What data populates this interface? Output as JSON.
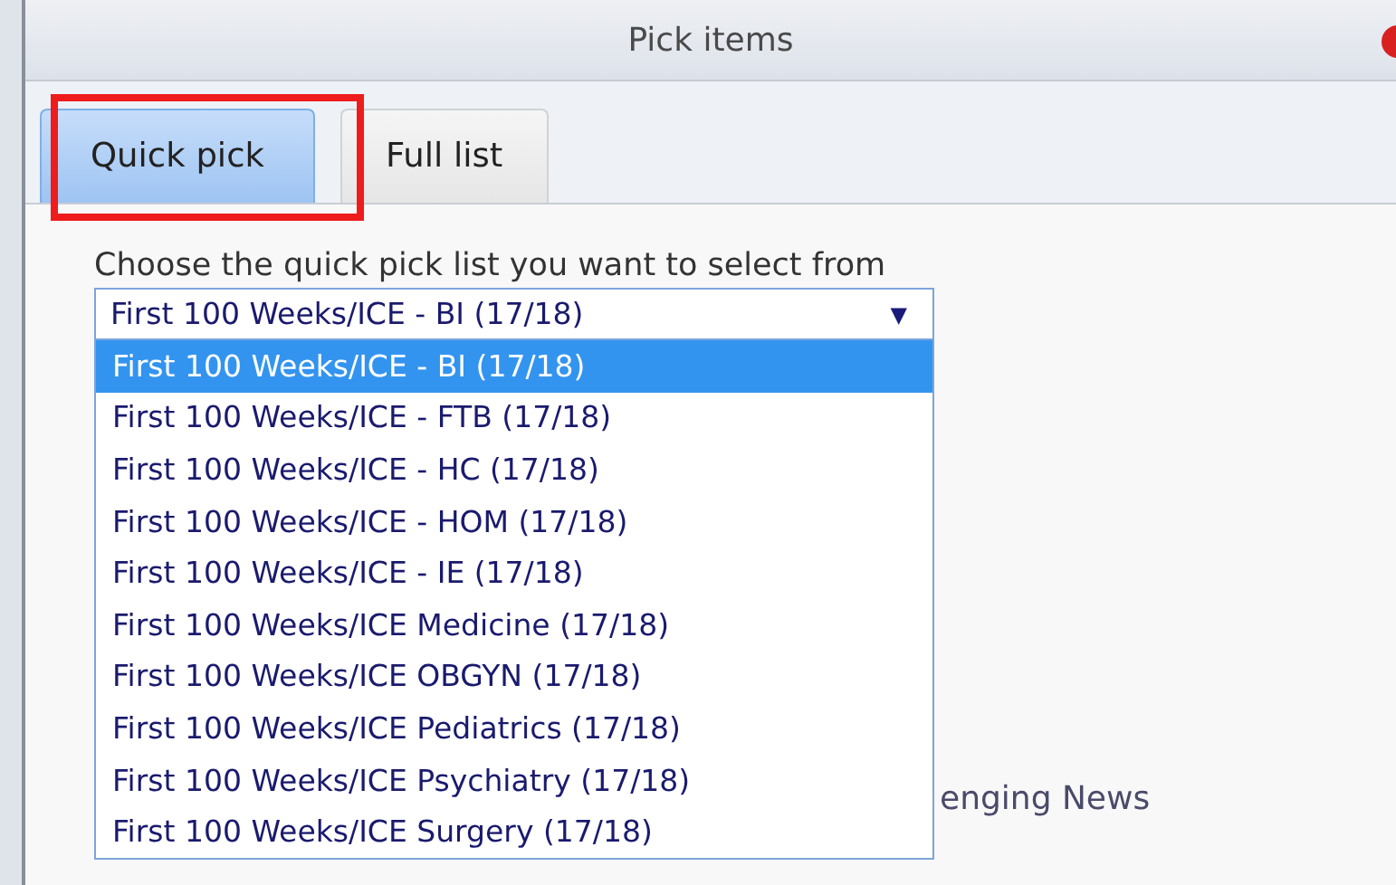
{
  "window": {
    "title": "Pick items"
  },
  "tabs": [
    {
      "label": "Quick pick",
      "selected": true
    },
    {
      "label": "Full list",
      "selected": false
    }
  ],
  "prompt": "Choose the quick pick list you want to select from",
  "select": {
    "value": "First 100 Weeks/ICE - BI (17/18)",
    "arrow": "▼",
    "expanded": true,
    "options": [
      {
        "label": "First 100 Weeks/ICE - BI (17/18)",
        "selected": true
      },
      {
        "label": "First 100 Weeks/ICE - FTB (17/18)",
        "selected": false
      },
      {
        "label": "First 100 Weeks/ICE - HC (17/18)",
        "selected": false
      },
      {
        "label": "First 100 Weeks/ICE - HOM (17/18)",
        "selected": false
      },
      {
        "label": "First 100 Weeks/ICE - IE (17/18)",
        "selected": false
      },
      {
        "label": "First 100 Weeks/ICE Medicine (17/18)",
        "selected": false
      },
      {
        "label": "First 100 Weeks/ICE OBGYN (17/18)",
        "selected": false
      },
      {
        "label": "First 100 Weeks/ICE Pediatrics (17/18)",
        "selected": false
      },
      {
        "label": "First 100 Weeks/ICE Psychiatry (17/18)",
        "selected": false
      },
      {
        "label": "First 100 Weeks/ICE Surgery (17/18)",
        "selected": false
      }
    ]
  },
  "background_text": "enging News"
}
